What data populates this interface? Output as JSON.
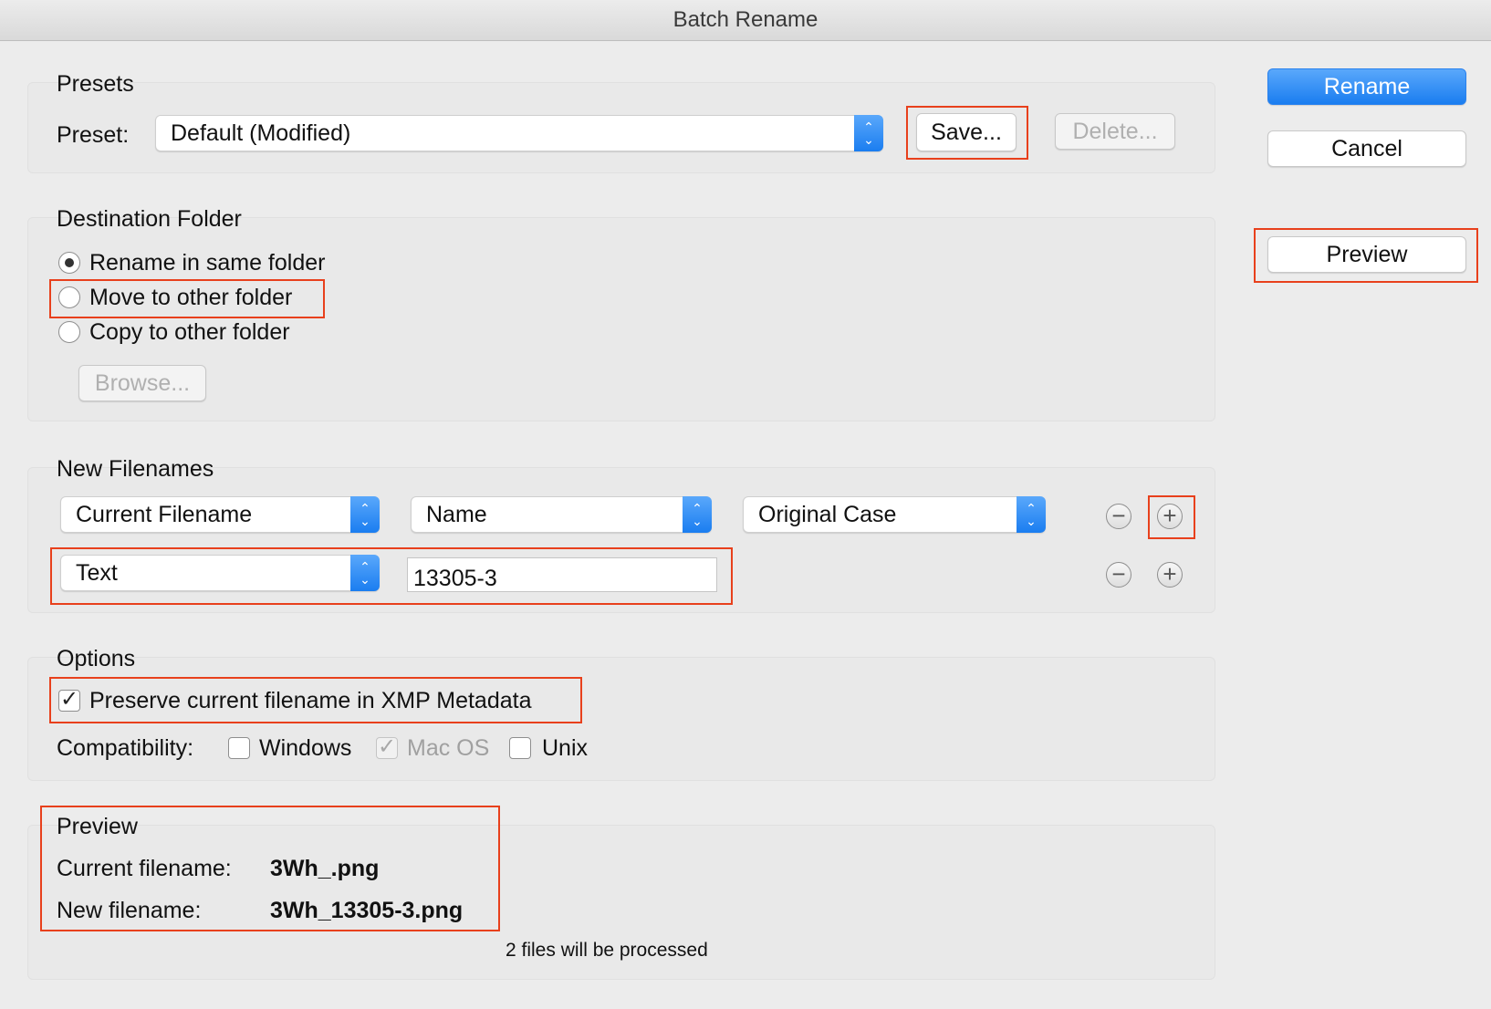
{
  "window": {
    "title": "Batch Rename"
  },
  "presets": {
    "group_title": "Presets",
    "preset_label": "Preset:",
    "preset_value": "Default (Modified)",
    "save_label": "Save...",
    "delete_label": "Delete..."
  },
  "destination": {
    "group_title": "Destination Folder",
    "options": [
      {
        "label": "Rename in same folder",
        "selected": true
      },
      {
        "label": "Move to other folder",
        "selected": false
      },
      {
        "label": "Copy to other folder",
        "selected": false
      }
    ],
    "browse_label": "Browse..."
  },
  "new_filenames": {
    "group_title": "New Filenames",
    "rows": [
      {
        "type": "Current Filename",
        "part": "Name",
        "case": "Original Case"
      },
      {
        "type": "Text",
        "text_value": "13305-3"
      }
    ]
  },
  "options": {
    "group_title": "Options",
    "preserve_label": "Preserve current filename in XMP Metadata",
    "preserve_checked": true,
    "compat_label": "Compatibility:",
    "compat": [
      {
        "label": "Windows",
        "checked": false
      },
      {
        "label": "Mac OS",
        "checked": true,
        "disabled": true
      },
      {
        "label": "Unix",
        "checked": false
      }
    ]
  },
  "preview": {
    "group_title": "Preview",
    "current_label": "Current filename:",
    "current_value": "3Wh_.png",
    "new_label": "New filename:",
    "new_value": "3Wh_13305-3.png",
    "summary": "2 files will be processed"
  },
  "actions": {
    "rename_label": "Rename",
    "cancel_label": "Cancel",
    "preview_label": "Preview"
  },
  "colors": {
    "accent": "#1a7df0",
    "highlight": "#e8401c"
  }
}
